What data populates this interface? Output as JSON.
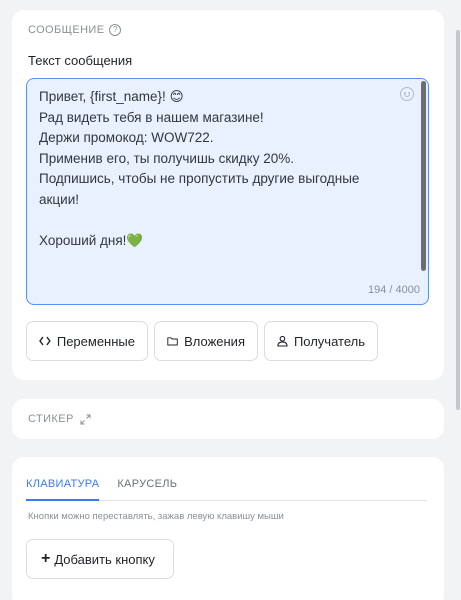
{
  "message_section": {
    "title": "СООБЩЕНИЕ",
    "help_glyph": "?",
    "field_label": "Текст сообщения",
    "text": "Привет, {first_name}! 😊\nРад видеть тебя в нашем магазине!\nДержи промокод: WOW722.\nПрименив его, ты получишь скидку 20%.\nПодпишись, чтобы не пропустить другие выгодные акции!\n\nХороший дня!💚",
    "counter": "194 / 4000",
    "buttons": {
      "variables": "Переменные",
      "attachments": "Вложения",
      "recipient": "Получатель"
    }
  },
  "sticker_section": {
    "title": "СТИКЕР"
  },
  "keyboard_section": {
    "tabs": [
      "КЛАВИАТУРА",
      "КАРУСЕЛЬ"
    ],
    "active_tab": "КЛАВИАТУРА",
    "hint": "Кнопки можно переставлять, зажав левую клавишу мыши",
    "add_button": "Добавить кнопку"
  },
  "colors": {
    "accent": "#3a7bed",
    "textarea_bg": "#e9f1fe",
    "textarea_border": "#5b8ff0",
    "page_bg": "#f2f3f5"
  },
  "icons": {
    "help": "help-circle-icon",
    "emoji": "emoji-smile-icon",
    "variables": "code-brackets-icon",
    "attachments": "folder-icon",
    "recipient": "user-icon",
    "expand": "expand-arrows-icon",
    "add": "plus-icon"
  }
}
